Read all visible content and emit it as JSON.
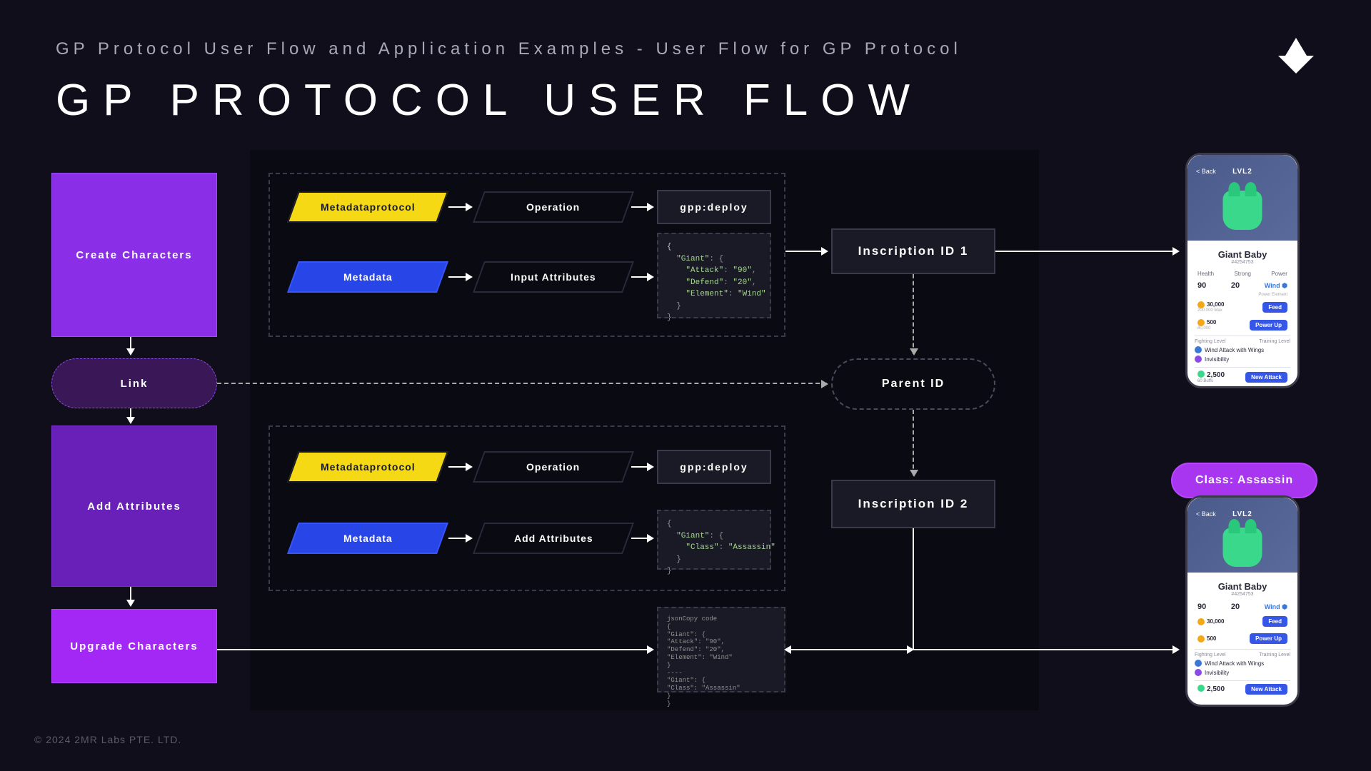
{
  "header": {
    "subtitle": "GP Protocol User Flow and Application Examples - User Flow for GP Protocol",
    "title": "GP PROTOCOL USER FLOW"
  },
  "footer": "© 2024 2MR Labs PTE. LTD.",
  "left": {
    "create": "Create Characters",
    "link": "Link",
    "add": "Add Attributes",
    "upgrade": "Upgrade Characters"
  },
  "flow1": {
    "protocol": "Metadataprotocol",
    "op_label": "Operation",
    "op_value": "gpp:deploy",
    "meta": "Metadata",
    "meta_label": "Input Attributes",
    "code": "{\n  \"Giant\": {\n    \"Attack\": \"90\",\n    \"Defend\": \"20\",\n    \"Element\": \"Wind\"\n  }\n}"
  },
  "flow2": {
    "protocol": "Metadataprotocol",
    "op_label": "Operation",
    "op_value": "gpp:deploy",
    "meta": "Metadata",
    "meta_label": "Add Attributes",
    "code": "{\n  \"Giant\": {\n    \"Class\": \"Assassin\"\n  }\n}"
  },
  "inscription1": "Inscription ID 1",
  "parent_id": "Parent ID",
  "inscription2": "Inscription ID 2",
  "merged_code": "jsonCopy code\n{\n\"Giant\": {\n\"Attack\": \"90\",\n\"Defend\": \"20\",\n\"Element\": \"Wind\"\n}\n----\n\"Giant\": {\n\"Class\": \"Assassin\"\n}\n}",
  "class_badge": "Class: Assassin",
  "phone": {
    "back": "< Back",
    "lvl": "LVL2",
    "name": "Giant Baby",
    "sub": "#4254753",
    "stat_labels": [
      "Health",
      "Strong",
      "Power"
    ],
    "attack": "90",
    "defend": "20",
    "element": "Wind",
    "element_sub": "Power Element",
    "coin1": "30,000",
    "coin1_sub": "200,000 Max",
    "btn_feed": "Feed",
    "coin2": "500",
    "coin2_sub": "80,000",
    "btn_power": "Power Up",
    "fight_label": "Fighting Level",
    "train_label": "Training Level",
    "skill1": "Wind Attack with Wings",
    "skill2": "Invisibility",
    "bottom_num": "2,500",
    "bottom_sub": "60 Buffs",
    "btn_attack": "New Attack"
  }
}
